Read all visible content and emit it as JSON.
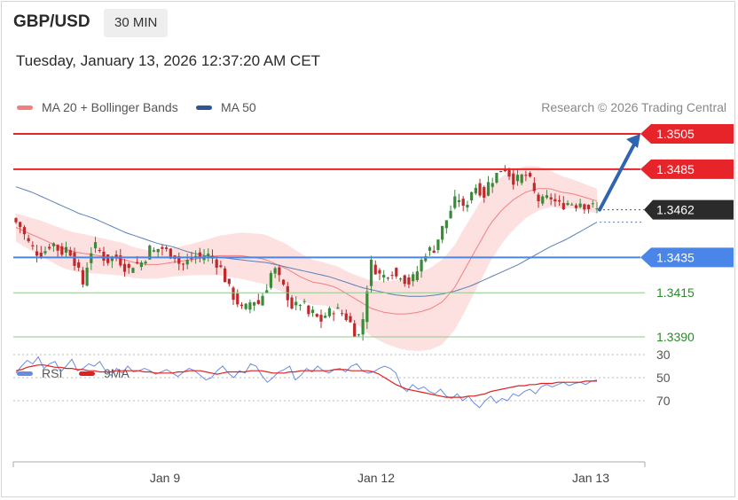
{
  "header": {
    "symbol": "GBP/USD",
    "timeframe": "30 MIN",
    "timestamp": "Tuesday, January 13, 2026 12:37:20 AM CET"
  },
  "legend": {
    "ma20": "MA 20 + Bollinger Bands",
    "ma50": "MA 50",
    "credit": "Research © 2026 Trading Central"
  },
  "rsi_legend": {
    "rsi": "RSI",
    "ma9": "9MA"
  },
  "colors": {
    "resistance": "#e8242b",
    "support_key": "#4a86e8",
    "support": "#8fc98a",
    "current": "#2b2b2b",
    "bull": "#3a8a3a",
    "bear": "#c0282a",
    "ma20": "#f08080",
    "ma50": "#5b7fb8",
    "band": "#fde0e0",
    "arrow": "#2f64b0",
    "rsi": "#6b8be0",
    "rsi_ma": "#e02020"
  },
  "chart_data": [
    {
      "type": "candlestick",
      "x_labels": [
        "Jan 9",
        "Jan 12",
        "Jan 13"
      ],
      "ylim": [
        1.3382,
        1.3522
      ],
      "levels": [
        {
          "label": "1.3505",
          "value": 1.3505,
          "kind": "resistance"
        },
        {
          "label": "1.3485",
          "value": 1.3485,
          "kind": "resistance"
        },
        {
          "label": "1.3462",
          "value": 1.3462,
          "kind": "current"
        },
        {
          "label": "1.3435",
          "value": 1.3435,
          "kind": "support-key"
        },
        {
          "label": "1.3415",
          "value": 1.3415,
          "kind": "support"
        },
        {
          "label": "1.3390",
          "value": 1.339,
          "kind": "support"
        }
      ],
      "close_path": [
        1.3455,
        1.3452,
        1.3445,
        1.3441,
        1.3438,
        1.3437,
        1.344,
        1.3444,
        1.344,
        1.3438,
        1.3441,
        1.3436,
        1.3428,
        1.342,
        1.3433,
        1.3442,
        1.344,
        1.3435,
        1.3433,
        1.3436,
        1.3434,
        1.343,
        1.3428,
        1.3432,
        1.3431,
        1.3434,
        1.344,
        1.3438,
        1.3441,
        1.3439,
        1.3437,
        1.3436,
        1.343,
        1.3432,
        1.3434,
        1.3436,
        1.3435,
        1.3437,
        1.3435,
        1.3432,
        1.3428,
        1.342,
        1.3414,
        1.341,
        1.3405,
        1.3407,
        1.3412,
        1.3408,
        1.3414,
        1.342,
        1.343,
        1.3424,
        1.3418,
        1.3412,
        1.3405,
        1.341,
        1.3408,
        1.3402,
        1.3404,
        1.3398,
        1.3402,
        1.3404,
        1.3406,
        1.3404,
        1.3402,
        1.3398,
        1.3392,
        1.339,
        1.3412,
        1.3432,
        1.3428,
        1.3424,
        1.3425,
        1.3428,
        1.3424,
        1.3426,
        1.342,
        1.3422,
        1.3427,
        1.3434,
        1.344,
        1.3438,
        1.3445,
        1.3452,
        1.3458,
        1.3465,
        1.347,
        1.3462,
        1.3468,
        1.3476,
        1.3474,
        1.347,
        1.3478,
        1.348,
        1.3484,
        1.3486,
        1.3482,
        1.3478,
        1.348,
        1.3482,
        1.3478,
        1.347,
        1.3466,
        1.3468,
        1.3469,
        1.3466,
        1.3464,
        1.3466,
        1.3466,
        1.3465,
        1.3467,
        1.3463,
        1.3464,
        1.3462
      ],
      "ma20": [
        1.3452,
        1.3449,
        1.3446,
        1.3443,
        1.344,
        1.3438,
        1.3437,
        1.3436,
        1.3435,
        1.3434,
        1.3432,
        1.3431,
        1.3431,
        1.3432,
        1.3433,
        1.3434,
        1.3435,
        1.3436,
        1.3436,
        1.3436,
        1.3435,
        1.3434,
        1.3431,
        1.3428,
        1.3424,
        1.3421,
        1.342,
        1.3418,
        1.3414,
        1.341,
        1.3406,
        1.3404,
        1.3403,
        1.3403,
        1.3404,
        1.3406,
        1.341,
        1.3418,
        1.343,
        1.3442,
        1.3454,
        1.3462,
        1.3468,
        1.3472,
        1.3474,
        1.3474,
        1.3472,
        1.3471,
        1.3469,
        1.3467
      ],
      "ma50": [
        1.3475,
        1.3472,
        1.3468,
        1.3464,
        1.346,
        1.3457,
        1.3453,
        1.3449,
        1.3446,
        1.3443,
        1.3441,
        1.3438,
        1.3436,
        1.3435,
        1.3434,
        1.3433,
        1.3432,
        1.343,
        1.3428,
        1.3426,
        1.3424,
        1.3421,
        1.3418,
        1.3416,
        1.3414,
        1.3413,
        1.3413,
        1.3414,
        1.3416,
        1.3419,
        1.3423,
        1.3427,
        1.3431,
        1.3436,
        1.3441,
        1.3445,
        1.345,
        1.3455
      ],
      "band_width": [
        0.0008,
        0.001,
        0.0011,
        0.0011,
        0.001,
        0.0009,
        0.0008,
        0.0008,
        0.0009,
        0.0011,
        0.0013,
        0.0014,
        0.0014,
        0.0013,
        0.0012,
        0.0013,
        0.0016,
        0.0019,
        0.0022,
        0.0024,
        0.0024,
        0.0022,
        0.0018,
        0.0014,
        0.001,
        0.0008,
        0.0007
      ],
      "projection": {
        "from": 1.3462,
        "to": 1.3505
      }
    },
    {
      "type": "line",
      "series": [
        {
          "name": "RSI"
        },
        {
          "name": "9MA"
        }
      ],
      "ylim": [
        20,
        85
      ],
      "yticks": [
        70,
        50,
        30
      ],
      "rsi": [
        46,
        40,
        35,
        38,
        32,
        42,
        38,
        36,
        45,
        40,
        34,
        44,
        42,
        38,
        40,
        36,
        44,
        48,
        42,
        46,
        40,
        45,
        44,
        42,
        44,
        47,
        45,
        43,
        46,
        49,
        45,
        42,
        44,
        48,
        52,
        50,
        44,
        40,
        46,
        50,
        44,
        46,
        38,
        40,
        48,
        54,
        50,
        45,
        43,
        40,
        52,
        48,
        42,
        45,
        40,
        44,
        46,
        43,
        42,
        45,
        40,
        38,
        44,
        46,
        45,
        42,
        40,
        42,
        46,
        58,
        62,
        56,
        60,
        58,
        62,
        64,
        60,
        66,
        68,
        64,
        70,
        66,
        72,
        76,
        70,
        66,
        72,
        68,
        70,
        64,
        66,
        62,
        60,
        64,
        58,
        56,
        58,
        56,
        54,
        57,
        55,
        54,
        56,
        53,
        52
      ],
      "rsi_ma": [
        44,
        43,
        41,
        40,
        39,
        39,
        40,
        41,
        41,
        42,
        42,
        43,
        43,
        44,
        44,
        45,
        45,
        45,
        44,
        44,
        44,
        44,
        44,
        45,
        45,
        46,
        46,
        46,
        46,
        45,
        45,
        44,
        44,
        44,
        45,
        46,
        47,
        46,
        45,
        45,
        45,
        45,
        44,
        44,
        44,
        45,
        46,
        46,
        46,
        45,
        45,
        44,
        44,
        44,
        44,
        44,
        44,
        43,
        43,
        43,
        44,
        44,
        44,
        44,
        45,
        47,
        50,
        53,
        56,
        58,
        60,
        61,
        62,
        63,
        64,
        65,
        66,
        67,
        67,
        67,
        67,
        66,
        66,
        65,
        64,
        62,
        61,
        60,
        59,
        58,
        57,
        57,
        56,
        56,
        55,
        55,
        55,
        54,
        54,
        54,
        54,
        54,
        53,
        53,
        53
      ]
    }
  ]
}
